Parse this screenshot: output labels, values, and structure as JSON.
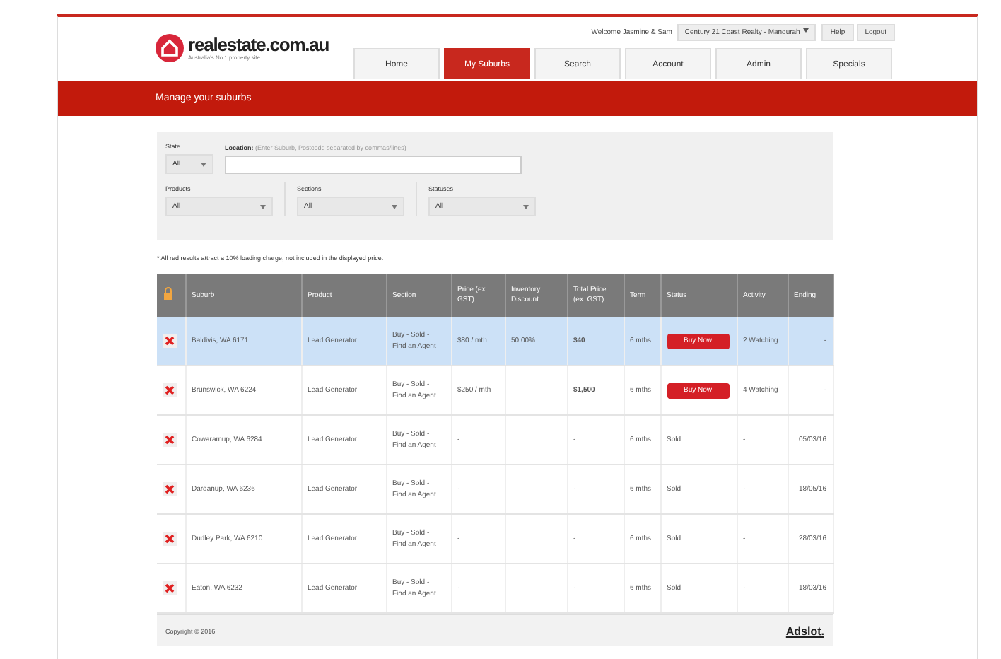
{
  "header": {
    "logo": "realestate.com.au",
    "tagline": "Australia's No.1 property site",
    "welcome": "Welcome Jasmine & Sam",
    "agency": "Century 21 Coast Realty - Mandurah",
    "links": [
      "Help",
      "Logout"
    ]
  },
  "tabs": [
    {
      "label": "Home",
      "selected": false
    },
    {
      "label": "My Suburbs",
      "selected": true
    },
    {
      "label": "Search",
      "selected": false
    },
    {
      "label": "Account",
      "selected": false
    },
    {
      "label": "Admin",
      "selected": false
    },
    {
      "label": "Specials",
      "selected": false
    }
  ],
  "page_title": "Manage your suburbs",
  "filters": {
    "state": {
      "label": "State",
      "value": "All"
    },
    "location": {
      "label": "Location:",
      "hint": "(Enter Suburb, Postcode separated by commas/lines)"
    },
    "dropdowns": [
      {
        "label": "Products",
        "value": "All"
      },
      {
        "label": "Sections",
        "value": "All"
      },
      {
        "label": "Statuses",
        "value": "All"
      }
    ]
  },
  "note": "* All red results attract a 10% loading charge, not included in the displayed price.",
  "table": {
    "columns": [
      "Suburb",
      "Product",
      "Section",
      "Price (ex. GST)",
      "Inventory Discount",
      "Total Price (ex. GST)",
      "Term",
      "Status",
      "Activity",
      "Ending"
    ],
    "rows": [
      {
        "selected": true,
        "suburb": "Baldivis, WA 6171",
        "product": "Lead Generator",
        "section": "Buy - Sold - Find an Agent",
        "price": "$80 / mth",
        "discount": "50.00%",
        "total": "$40",
        "term": "6 mths",
        "status": {
          "kind": "button",
          "text": "Buy Now"
        },
        "activity": "2 Watching",
        "ending": "-"
      },
      {
        "selected": false,
        "suburb": "Brunswick, WA 6224",
        "product": "Lead Generator",
        "section": "Buy - Sold - Find an Agent",
        "price": "$250 / mth",
        "discount": "",
        "total": "$1,500",
        "term": "6 mths",
        "status": {
          "kind": "button",
          "text": "Buy Now"
        },
        "activity": "4 Watching",
        "ending": "-"
      },
      {
        "selected": false,
        "suburb": "Cowaramup, WA 6284",
        "product": "Lead Generator",
        "section": "Buy - Sold - Find an Agent",
        "price": "-",
        "discount": "",
        "total": "-",
        "term": "6 mths",
        "status": {
          "kind": "text",
          "text": "Sold"
        },
        "activity": "-",
        "ending": "05/03/16"
      },
      {
        "selected": false,
        "suburb": "Dardanup, WA 6236",
        "product": "Lead Generator",
        "section": "Buy - Sold - Find an Agent",
        "price": "-",
        "discount": "",
        "total": "-",
        "term": "6 mths",
        "status": {
          "kind": "text",
          "text": "Sold"
        },
        "activity": "-",
        "ending": "18/05/16"
      },
      {
        "selected": false,
        "suburb": "Dudley Park, WA 6210",
        "product": "Lead Generator",
        "section": "Buy - Sold - Find an Agent",
        "price": "-",
        "discount": "",
        "total": "-",
        "term": "6 mths",
        "status": {
          "kind": "text",
          "text": "Sold"
        },
        "activity": "-",
        "ending": "28/03/16"
      },
      {
        "selected": false,
        "suburb": "Eaton, WA 6232",
        "product": "Lead Generator",
        "section": "Buy - Sold - Find an Agent",
        "price": "-",
        "discount": "",
        "total": "-",
        "term": "6 mths",
        "status": {
          "kind": "text",
          "text": "Sold"
        },
        "activity": "-",
        "ending": "18/03/16"
      }
    ]
  },
  "footer": {
    "copyright": "Copyright © 2016",
    "brand": "Adslot."
  }
}
